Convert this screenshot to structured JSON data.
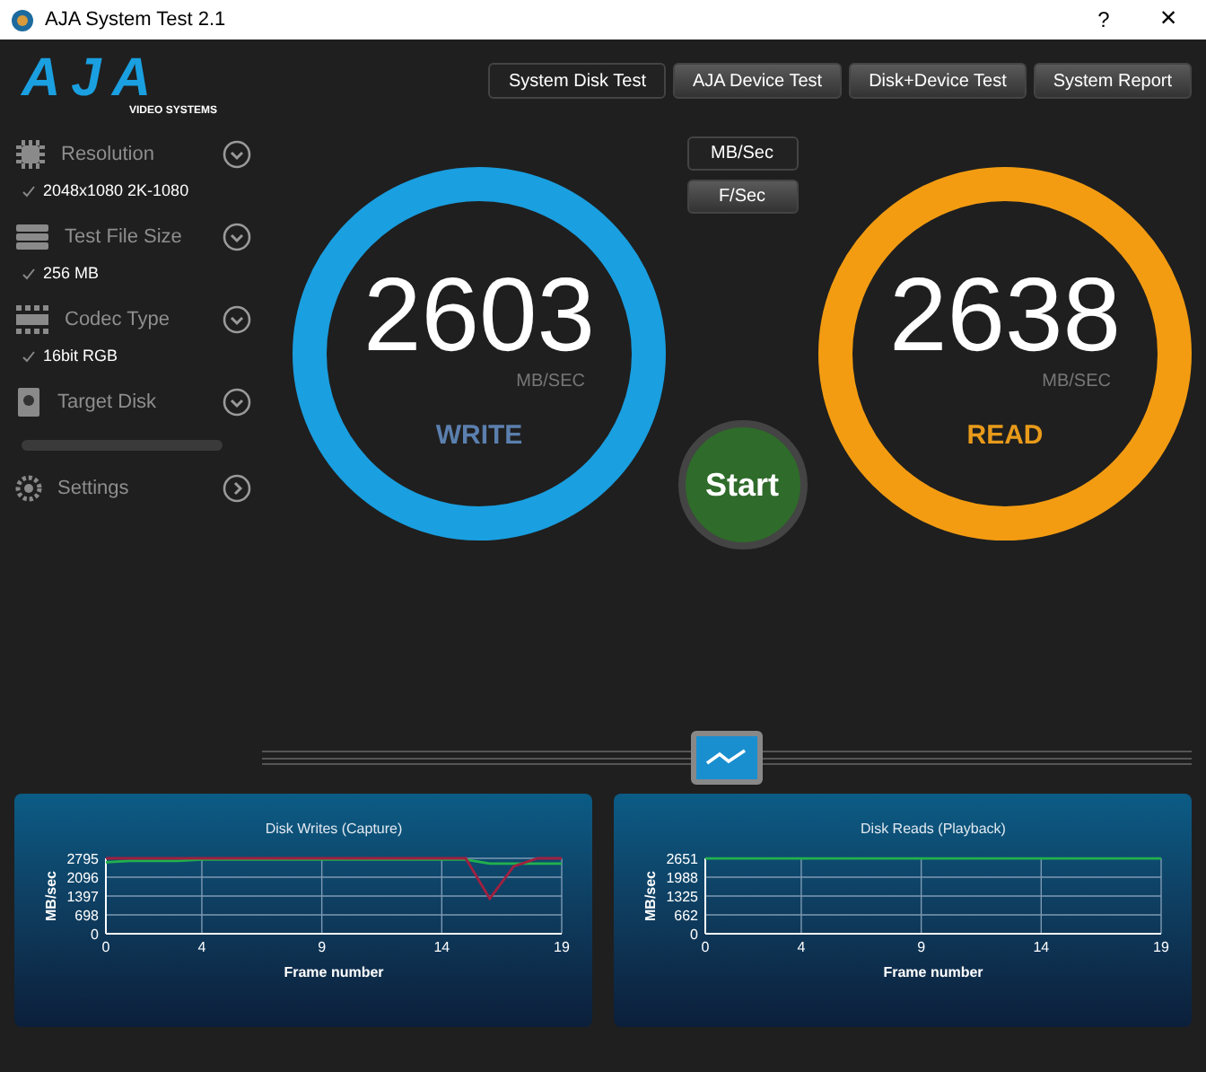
{
  "window": {
    "title": "AJA System Test 2.1",
    "help": "?",
    "close": "×"
  },
  "logo": {
    "brand": "AJA",
    "subtitle": "VIDEO SYSTEMS"
  },
  "tabs": [
    {
      "label": "System Disk Test",
      "selected": true
    },
    {
      "label": "AJA Device Test",
      "selected": false
    },
    {
      "label": "Disk+Device Test",
      "selected": false
    },
    {
      "label": "System Report",
      "selected": false
    }
  ],
  "sidebar": {
    "items": [
      {
        "kind": "dropdown",
        "label": "Resolution",
        "value": "2048x1080 2K-1080"
      },
      {
        "kind": "dropdown",
        "label": "Test File Size",
        "value": "256 MB"
      },
      {
        "kind": "dropdown",
        "label": "Codec Type",
        "value": "16bit RGB"
      },
      {
        "kind": "dropdown",
        "label": "Target Disk"
      },
      {
        "kind": "progress",
        "level": 0
      },
      {
        "kind": "link",
        "label": "Settings"
      }
    ]
  },
  "units": [
    {
      "label": "MB/Sec",
      "selected": true
    },
    {
      "label": "F/Sec",
      "selected": false
    }
  ],
  "gauges": [
    {
      "kind": "write",
      "value": "2603",
      "unit": "MB/SEC",
      "label": "WRITE",
      "color": "#1a9fe0"
    },
    {
      "kind": "read",
      "value": "2638",
      "unit": "MB/SEC",
      "label": "READ",
      "color": "#f39c12"
    }
  ],
  "start_button": {
    "label": "Start"
  },
  "charts": [
    {
      "chart_data": {
        "type": "line",
        "title": "Disk Writes (Capture)",
        "xlabel": "Frame number",
        "ylabel": "MB/sec",
        "x": [
          0,
          1,
          2,
          3,
          4,
          5,
          6,
          7,
          8,
          9,
          10,
          11,
          12,
          13,
          14,
          15,
          16,
          17,
          18,
          19
        ],
        "xlim": [
          0,
          19
        ],
        "ylim": [
          0,
          2795
        ],
        "yticks": [
          0,
          698,
          1397,
          2096,
          2795
        ],
        "xticks": [
          0,
          4,
          9,
          14,
          19
        ],
        "grid": true,
        "series": [
          {
            "color": "#22b14c",
            "values": [
              2650,
              2700,
              2700,
              2700,
              2750,
              2750,
              2750,
              2750,
              2750,
              2750,
              2750,
              2750,
              2750,
              2750,
              2750,
              2750,
              2600,
              2600,
              2600,
              2600
            ]
          },
          {
            "color": "#a02040",
            "values": [
              2795,
              2795,
              2795,
              2795,
              2795,
              2795,
              2795,
              2795,
              2795,
              2795,
              2795,
              2795,
              2795,
              2795,
              2795,
              2795,
              1300,
              2500,
              2795,
              2795
            ]
          }
        ]
      }
    },
    {
      "chart_data": {
        "type": "line",
        "title": "Disk Reads (Playback)",
        "xlabel": "Frame number",
        "ylabel": "MB/sec",
        "x": [
          0,
          1,
          2,
          3,
          4,
          5,
          6,
          7,
          8,
          9,
          10,
          11,
          12,
          13,
          14,
          15,
          16,
          17,
          18,
          19
        ],
        "xlim": [
          0,
          19
        ],
        "ylim": [
          0,
          2651
        ],
        "yticks": [
          0,
          662,
          1325,
          1988,
          2651
        ],
        "xticks": [
          0,
          4,
          9,
          14,
          19
        ],
        "grid": true,
        "series": [
          {
            "color": "#22b14c",
            "values": [
              2650,
              2650,
              2650,
              2650,
              2650,
              2650,
              2650,
              2650,
              2650,
              2650,
              2650,
              2650,
              2650,
              2650,
              2650,
              2650,
              2650,
              2650,
              2650,
              2650
            ]
          }
        ]
      }
    }
  ]
}
